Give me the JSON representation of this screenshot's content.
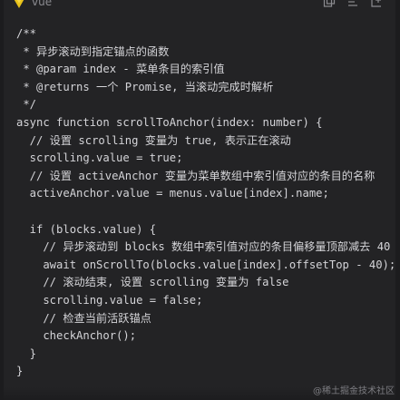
{
  "header": {
    "language_label": "vue",
    "language_icon": "vue-logo-icon",
    "toolbar": [
      {
        "icon": "copy-icon"
      },
      {
        "icon": "format-icon"
      },
      {
        "icon": "insert-icon"
      }
    ]
  },
  "code": {
    "lines": [
      "/**",
      " * 异步滚动到指定锚点的函数",
      " * @param index - 菜单条目的索引值",
      " * @returns 一个 Promise, 当滚动完成时解析",
      " */",
      "async function scrollToAnchor(index: number) {",
      "  // 设置 scrolling 变量为 true, 表示正在滚动",
      "  scrolling.value = true;",
      "  // 设置 activeAnchor 变量为菜单数组中索引值对应的条目的名称",
      "  activeAnchor.value = menus.value[index].name;",
      "",
      "  if (blocks.value) {",
      "    // 异步滚动到 blocks 数组中索引值对应的条目偏移量顶部减去 40",
      "    await onScrollTo(blocks.value[index].offsetTop - 40);",
      "    // 滚动结束, 设置 scrolling 变量为 false",
      "    scrolling.value = false;",
      "    // 检查当前活跃锚点",
      "    checkAnchor();",
      "  }",
      "}"
    ]
  },
  "watermark": "@稀土掘金技术社区",
  "colors": {
    "background": "#232325",
    "text": "#d4d4d8",
    "muted": "#8b8b90"
  }
}
